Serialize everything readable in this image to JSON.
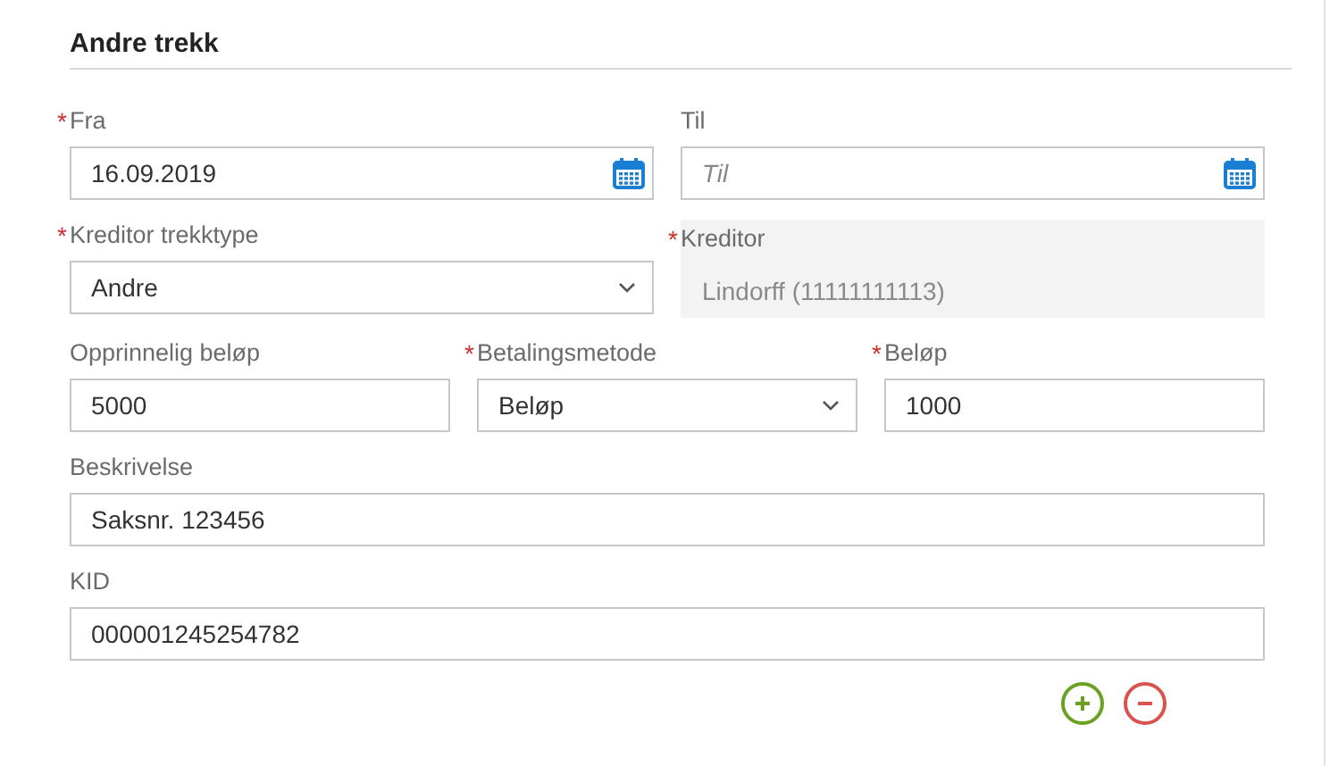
{
  "section": {
    "title": "Andre trekk"
  },
  "rows": [
    [
      {
        "label": "Fra",
        "required_mark": "*",
        "kind": "date",
        "value": "16.09.2019",
        "disabled": false
      },
      {
        "label": "Til",
        "kind": "date",
        "placeholder": "Til",
        "disabled": false
      }
    ],
    [
      {
        "label": "Kreditor trekktype",
        "required_mark": "*",
        "kind": "select",
        "value": "Andre",
        "disabled": false
      },
      {
        "label": "Kreditor",
        "required_mark": "*",
        "kind": "text",
        "value": "Lindorff (11111111113)",
        "disabled": true
      }
    ],
    [
      {
        "label": "Opprinnelig beløp",
        "kind": "text",
        "value": "5000",
        "disabled": false
      },
      {
        "label": "Betalingsmetode",
        "required_mark": "*",
        "kind": "select",
        "value": "Beløp",
        "disabled": false
      },
      {
        "label": "Beløp",
        "required_mark": "*",
        "kind": "text",
        "value": "1000",
        "disabled": false
      }
    ],
    [
      {
        "label": "Beskrivelse",
        "kind": "text",
        "value": "Saksnr. 123456",
        "disabled": false
      }
    ],
    [
      {
        "label": "KID",
        "kind": "text",
        "value": "000001245254782",
        "disabled": false
      }
    ]
  ],
  "actions": [
    {
      "kind": "add"
    },
    {
      "kind": "remove"
    }
  ]
}
